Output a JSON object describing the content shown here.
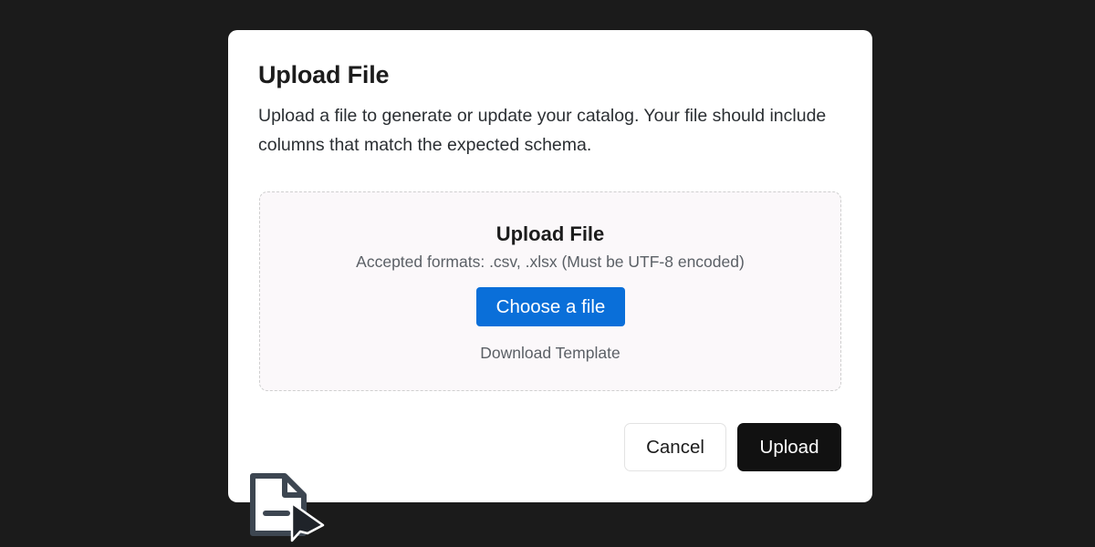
{
  "modal": {
    "title": "Upload File",
    "description": "Upload a file to generate or update your catalog. Your file should include columns that match the expected schema."
  },
  "dropzone": {
    "title": "Upload File",
    "formats": "Accepted formats: .csv, .xlsx (Must be UTF-8 encoded)",
    "choose_label": "Choose a file",
    "template_label": "Download Template"
  },
  "actions": {
    "cancel_label": "Cancel",
    "upload_label": "Upload"
  },
  "icons": {
    "dragged_file": "file-icon",
    "pointer": "cursor-arrow-icon"
  },
  "colors": {
    "background": "#1b1b1b",
    "primary_blue": "#0a6fd9",
    "upload_button": "#111111",
    "dropzone_bg": "#fbf8fa"
  }
}
